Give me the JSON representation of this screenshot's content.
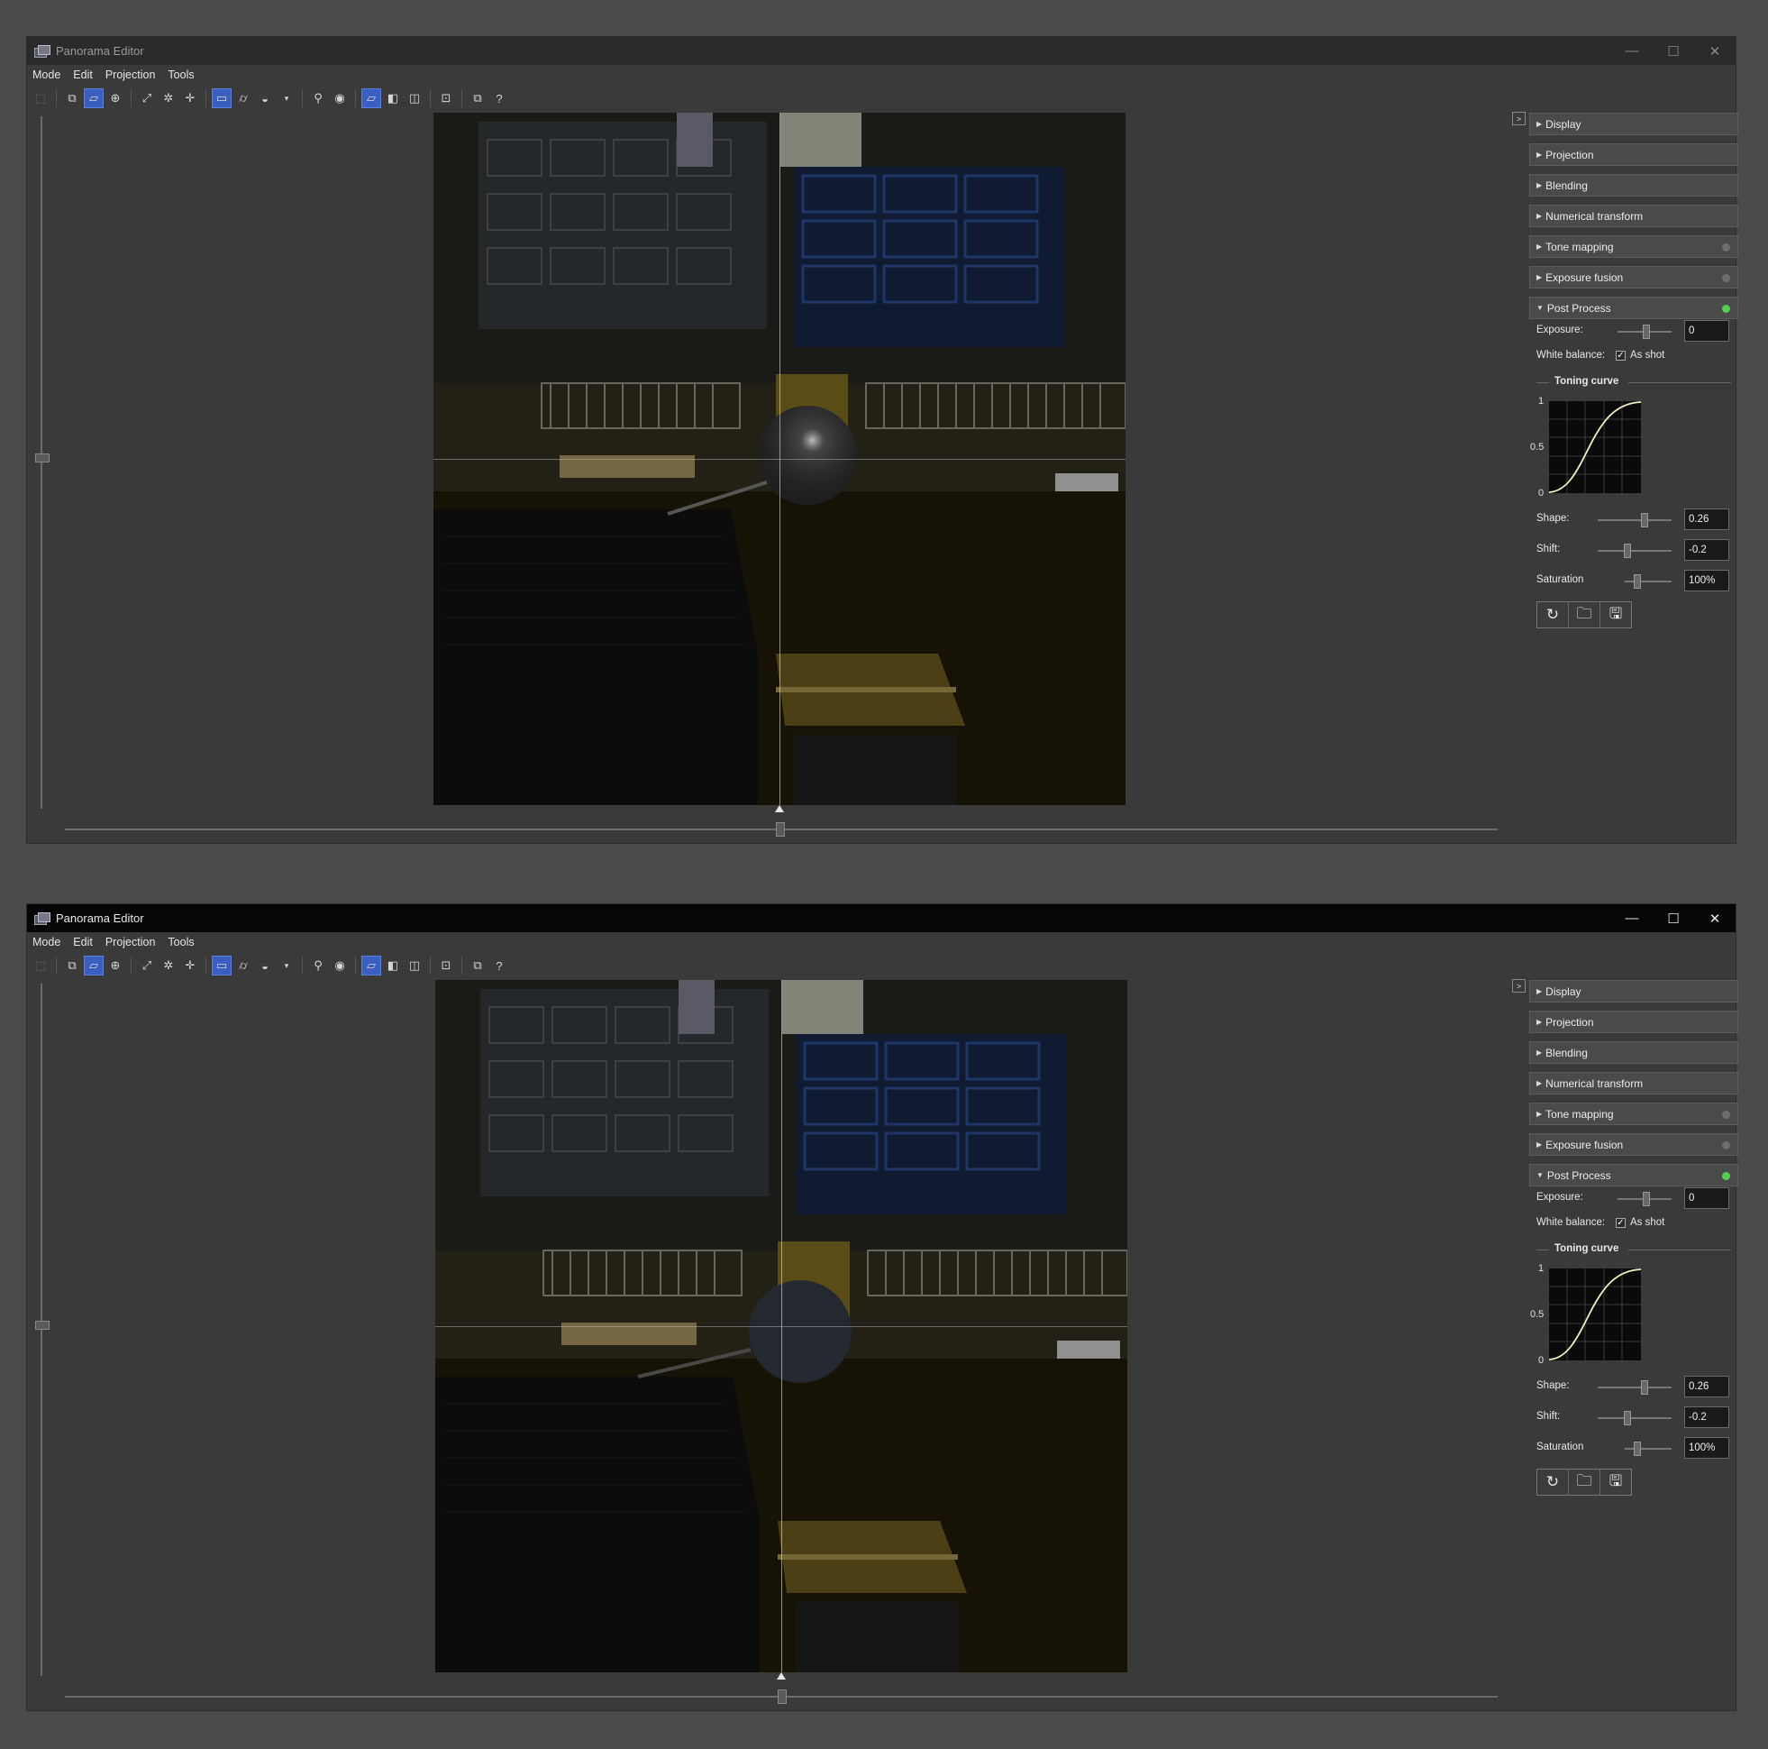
{
  "window": {
    "title": "Panorama Editor",
    "controls": {
      "minimize": "—",
      "maximize": "☐",
      "close": "✕"
    }
  },
  "menu": [
    "Mode",
    "Edit",
    "Projection",
    "Tools"
  ],
  "toolbar": {
    "icons": [
      "select-icon",
      "preview-icon",
      "fast-preview-icon",
      "crosshair-icon",
      "fit-icon",
      "center-icon",
      "straighten-icon",
      "rectilinear-icon",
      "cylindrical-icon",
      "spherical-icon",
      "dropdown-icon",
      "zoom-icon",
      "view-icon",
      "full-view-icon",
      "half-view-icon",
      "compare-icon",
      "identify-icon",
      "panels-icon",
      "help-icon"
    ]
  },
  "panel": {
    "sections": {
      "display": "Display",
      "projection": "Projection",
      "blending": "Blending",
      "numerical": "Numerical transform",
      "tone_mapping": "Tone mapping",
      "exposure_fusion": "Exposure fusion",
      "post_process": "Post Process"
    },
    "post": {
      "exposure_label": "Exposure:",
      "exposure_value": "0",
      "white_balance_label": "White balance:",
      "as_shot_label": "As shot",
      "as_shot_checked": true,
      "toning_curve_label": "Toning curve",
      "curve_ticks": [
        "1",
        "0.5",
        "0"
      ],
      "shape_label": "Shape:",
      "shape_value": "0.26",
      "shift_label": "Shift:",
      "shift_value": "-0.2",
      "saturation_label": "Saturation",
      "saturation_value": "100%"
    },
    "status_colors": {
      "inactive": "#6e6e6e",
      "active": "#4fd04f"
    },
    "collapse_glyph": ">"
  },
  "accent_color": "#3a5fc0"
}
